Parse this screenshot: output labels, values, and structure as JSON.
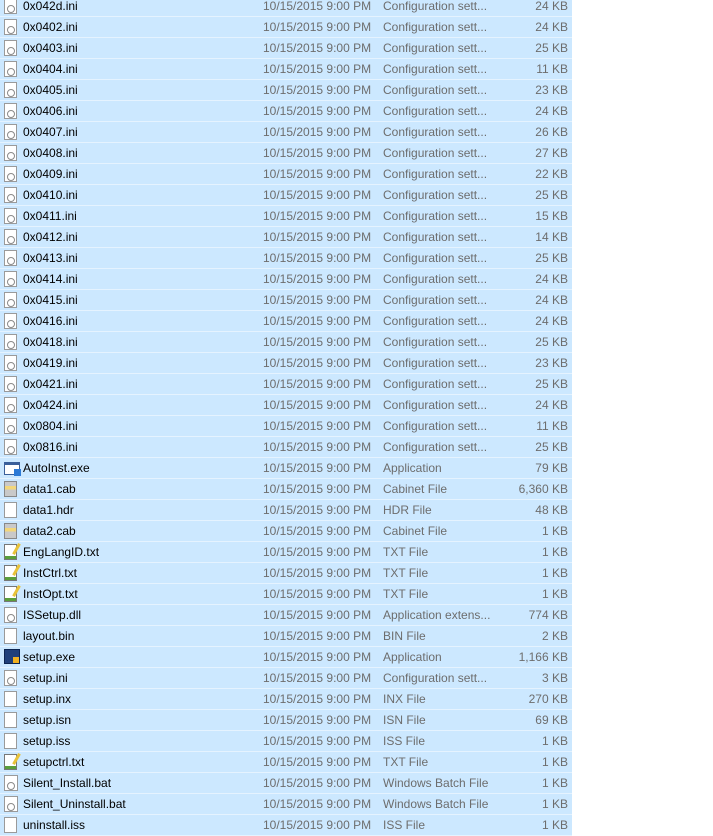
{
  "selection_color": "#cce8ff",
  "files": [
    {
      "name": "0x042d.ini",
      "date": "10/15/2015 9:00 PM",
      "type": "Configuration sett...",
      "size": "24 KB",
      "icon": "ini"
    },
    {
      "name": "0x0402.ini",
      "date": "10/15/2015 9:00 PM",
      "type": "Configuration sett...",
      "size": "24 KB",
      "icon": "ini"
    },
    {
      "name": "0x0403.ini",
      "date": "10/15/2015 9:00 PM",
      "type": "Configuration sett...",
      "size": "25 KB",
      "icon": "ini"
    },
    {
      "name": "0x0404.ini",
      "date": "10/15/2015 9:00 PM",
      "type": "Configuration sett...",
      "size": "11 KB",
      "icon": "ini"
    },
    {
      "name": "0x0405.ini",
      "date": "10/15/2015 9:00 PM",
      "type": "Configuration sett...",
      "size": "23 KB",
      "icon": "ini"
    },
    {
      "name": "0x0406.ini",
      "date": "10/15/2015 9:00 PM",
      "type": "Configuration sett...",
      "size": "24 KB",
      "icon": "ini"
    },
    {
      "name": "0x0407.ini",
      "date": "10/15/2015 9:00 PM",
      "type": "Configuration sett...",
      "size": "26 KB",
      "icon": "ini"
    },
    {
      "name": "0x0408.ini",
      "date": "10/15/2015 9:00 PM",
      "type": "Configuration sett...",
      "size": "27 KB",
      "icon": "ini"
    },
    {
      "name": "0x0409.ini",
      "date": "10/15/2015 9:00 PM",
      "type": "Configuration sett...",
      "size": "22 KB",
      "icon": "ini"
    },
    {
      "name": "0x0410.ini",
      "date": "10/15/2015 9:00 PM",
      "type": "Configuration sett...",
      "size": "25 KB",
      "icon": "ini"
    },
    {
      "name": "0x0411.ini",
      "date": "10/15/2015 9:00 PM",
      "type": "Configuration sett...",
      "size": "15 KB",
      "icon": "ini"
    },
    {
      "name": "0x0412.ini",
      "date": "10/15/2015 9:00 PM",
      "type": "Configuration sett...",
      "size": "14 KB",
      "icon": "ini"
    },
    {
      "name": "0x0413.ini",
      "date": "10/15/2015 9:00 PM",
      "type": "Configuration sett...",
      "size": "25 KB",
      "icon": "ini"
    },
    {
      "name": "0x0414.ini",
      "date": "10/15/2015 9:00 PM",
      "type": "Configuration sett...",
      "size": "24 KB",
      "icon": "ini"
    },
    {
      "name": "0x0415.ini",
      "date": "10/15/2015 9:00 PM",
      "type": "Configuration sett...",
      "size": "24 KB",
      "icon": "ini"
    },
    {
      "name": "0x0416.ini",
      "date": "10/15/2015 9:00 PM",
      "type": "Configuration sett...",
      "size": "24 KB",
      "icon": "ini"
    },
    {
      "name": "0x0418.ini",
      "date": "10/15/2015 9:00 PM",
      "type": "Configuration sett...",
      "size": "25 KB",
      "icon": "ini"
    },
    {
      "name": "0x0419.ini",
      "date": "10/15/2015 9:00 PM",
      "type": "Configuration sett...",
      "size": "23 KB",
      "icon": "ini"
    },
    {
      "name": "0x0421.ini",
      "date": "10/15/2015 9:00 PM",
      "type": "Configuration sett...",
      "size": "25 KB",
      "icon": "ini"
    },
    {
      "name": "0x0424.ini",
      "date": "10/15/2015 9:00 PM",
      "type": "Configuration sett...",
      "size": "24 KB",
      "icon": "ini"
    },
    {
      "name": "0x0804.ini",
      "date": "10/15/2015 9:00 PM",
      "type": "Configuration sett...",
      "size": "11 KB",
      "icon": "ini"
    },
    {
      "name": "0x0816.ini",
      "date": "10/15/2015 9:00 PM",
      "type": "Configuration sett...",
      "size": "25 KB",
      "icon": "ini"
    },
    {
      "name": "AutoInst.exe",
      "date": "10/15/2015 9:00 PM",
      "type": "Application",
      "size": "79 KB",
      "icon": "exe"
    },
    {
      "name": "data1.cab",
      "date": "10/15/2015 9:00 PM",
      "type": "Cabinet File",
      "size": "6,360 KB",
      "icon": "cab"
    },
    {
      "name": "data1.hdr",
      "date": "10/15/2015 9:00 PM",
      "type": "HDR File",
      "size": "48 KB",
      "icon": "blank"
    },
    {
      "name": "data2.cab",
      "date": "10/15/2015 9:00 PM",
      "type": "Cabinet File",
      "size": "1 KB",
      "icon": "cab"
    },
    {
      "name": "EngLangID.txt",
      "date": "10/15/2015 9:00 PM",
      "type": "TXT File",
      "size": "1 KB",
      "icon": "txt"
    },
    {
      "name": "InstCtrl.txt",
      "date": "10/15/2015 9:00 PM",
      "type": "TXT File",
      "size": "1 KB",
      "icon": "txt"
    },
    {
      "name": "InstOpt.txt",
      "date": "10/15/2015 9:00 PM",
      "type": "TXT File",
      "size": "1 KB",
      "icon": "txt"
    },
    {
      "name": "ISSetup.dll",
      "date": "10/15/2015 9:00 PM",
      "type": "Application extens...",
      "size": "774 KB",
      "icon": "dll"
    },
    {
      "name": "layout.bin",
      "date": "10/15/2015 9:00 PM",
      "type": "BIN File",
      "size": "2 KB",
      "icon": "blank"
    },
    {
      "name": "setup.exe",
      "date": "10/15/2015 9:00 PM",
      "type": "Application",
      "size": "1,166 KB",
      "icon": "setup"
    },
    {
      "name": "setup.ini",
      "date": "10/15/2015 9:00 PM",
      "type": "Configuration sett...",
      "size": "3 KB",
      "icon": "ini"
    },
    {
      "name": "setup.inx",
      "date": "10/15/2015 9:00 PM",
      "type": "INX File",
      "size": "270 KB",
      "icon": "blank"
    },
    {
      "name": "setup.isn",
      "date": "10/15/2015 9:00 PM",
      "type": "ISN File",
      "size": "69 KB",
      "icon": "blank"
    },
    {
      "name": "setup.iss",
      "date": "10/15/2015 9:00 PM",
      "type": "ISS File",
      "size": "1 KB",
      "icon": "blank"
    },
    {
      "name": "setupctrl.txt",
      "date": "10/15/2015 9:00 PM",
      "type": "TXT File",
      "size": "1 KB",
      "icon": "txt"
    },
    {
      "name": "Silent_Install.bat",
      "date": "10/15/2015 9:00 PM",
      "type": "Windows Batch File",
      "size": "1 KB",
      "icon": "bat"
    },
    {
      "name": "Silent_Uninstall.bat",
      "date": "10/15/2015 9:00 PM",
      "type": "Windows Batch File",
      "size": "1 KB",
      "icon": "bat"
    },
    {
      "name": "uninstall.iss",
      "date": "10/15/2015 9:00 PM",
      "type": "ISS File",
      "size": "1 KB",
      "icon": "blank"
    }
  ]
}
